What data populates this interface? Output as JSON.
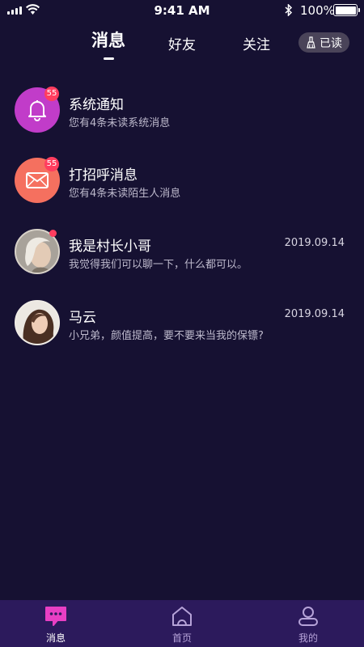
{
  "status_bar": {
    "time": "9:41 AM",
    "battery": "100%",
    "icons": [
      "signal-icon",
      "wifi-icon",
      "bluetooth-icon",
      "battery-icon"
    ]
  },
  "tabs": {
    "items": [
      {
        "label": "消息",
        "active": true
      },
      {
        "label": "好友",
        "active": false
      },
      {
        "label": "关注",
        "active": false
      }
    ],
    "mark_read": {
      "label": "已读",
      "icon": "broom-icon"
    }
  },
  "messages": [
    {
      "title": "系统通知",
      "subtitle": "您有4条未读系统消息",
      "date": "",
      "badge": "55",
      "icon": "bell-icon",
      "color": "#c13cc9"
    },
    {
      "title": "打招呼消息",
      "subtitle": "您有4条未读陌生人消息",
      "date": "",
      "badge": "55",
      "icon": "envelope-icon",
      "color": "#f5705f"
    },
    {
      "title": "我是村长小哥",
      "subtitle": "我觉得我们可以聊一下，什么都可以。",
      "date": "2019.09.14",
      "unread_dot": true,
      "avatar": "avatar-photo"
    },
    {
      "title": "马云",
      "subtitle": "小兄弟，颜值提高，要不要来当我的保镖?",
      "date": "2019.09.14",
      "avatar": "avatar-photo"
    }
  ],
  "bottom_nav": {
    "items": [
      {
        "label": "消息",
        "icon": "chat-bubble-icon",
        "active": true
      },
      {
        "label": "首页",
        "icon": "home-icon",
        "active": false
      },
      {
        "label": "我的",
        "icon": "profile-icon",
        "active": false
      }
    ]
  },
  "colors": {
    "background": "#161132",
    "nav_background": "#2c1a5c",
    "badge": "#ff3d5f",
    "active_nav": "#e83fc4"
  }
}
